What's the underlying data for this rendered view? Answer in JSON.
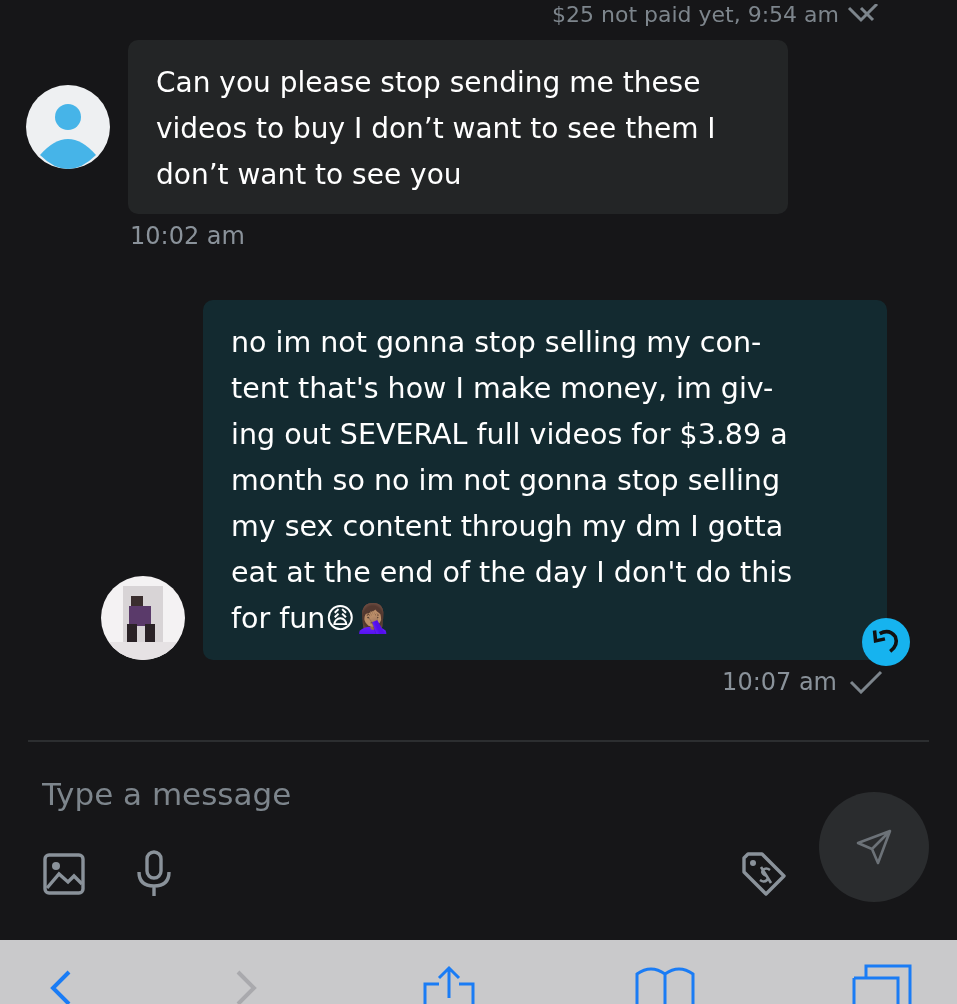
{
  "top_status": {
    "text": "$25 not paid yet, 9:54 am"
  },
  "messages": [
    {
      "kind": "incoming",
      "text": "Can you please stop sending me these\nvideos to buy I don’t want to see them I\ndon’t want to see you",
      "time": "10:02 am"
    },
    {
      "kind": "outgoing",
      "text": "no im not gonna stop selling my con-\ntent that's how I make money, im giv-\ning out SEVERAL full videos for $3.89 a\nmonth so no im not gonna stop selling\nmy sex content through my dm I gotta\neat at the end of the day I don't do this\nfor fun😩🤦🏽‍♀️",
      "time": "10:07 am",
      "read": true,
      "reply_badge": true
    }
  ],
  "composer": {
    "placeholder": "Type a message",
    "send_disabled": true
  },
  "browser_toolbar": {
    "forward_disabled": true
  }
}
